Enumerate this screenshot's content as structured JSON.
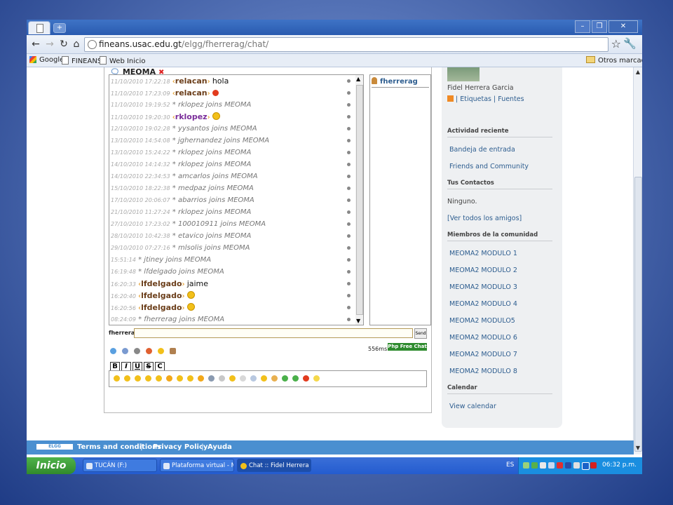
{
  "browser": {
    "url_host": "fineans.usac.edu.gt",
    "url_path": "/elgg/fherrerag/chat/",
    "bookmarks": [
      "Google",
      "FINEANS",
      "Web Inicio"
    ],
    "other_bookmarks": "Otros marcadores"
  },
  "chat": {
    "room_tab": "MEOMA",
    "messages": [
      {
        "ts": "11/10/2010 17:22:18",
        "nick": "relacan",
        "text": "hola",
        "kind": "msg"
      },
      {
        "ts": "11/10/2010 17:23:09",
        "nick": "relacan",
        "text": "",
        "kind": "alert"
      },
      {
        "ts": "11/10/2010 19:19:52",
        "text": "* rklopez joins MEOMA",
        "kind": "join"
      },
      {
        "ts": "11/10/2010 19:20:30",
        "nick": "rklopez",
        "text": "",
        "kind": "smile",
        "purple": true
      },
      {
        "ts": "12/10/2010 19:02:28",
        "text": "* yysantos joins MEOMA",
        "kind": "join"
      },
      {
        "ts": "13/10/2010 14:54:08",
        "text": "* jghernandez joins MEOMA",
        "kind": "join"
      },
      {
        "ts": "13/10/2010 15:24:22",
        "text": "* rklopez joins MEOMA",
        "kind": "join"
      },
      {
        "ts": "14/10/2010 14:14:32",
        "text": "* rklopez joins MEOMA",
        "kind": "join"
      },
      {
        "ts": "14/10/2010 22:34:53",
        "text": "* amcarlos joins MEOMA",
        "kind": "join"
      },
      {
        "ts": "15/10/2010 18:22:38",
        "text": "* medpaz joins MEOMA",
        "kind": "join"
      },
      {
        "ts": "17/10/2010 20:06:07",
        "text": "* abarrios joins MEOMA",
        "kind": "join"
      },
      {
        "ts": "21/10/2010 11:27:24",
        "text": "* rklopez joins MEOMA",
        "kind": "join"
      },
      {
        "ts": "27/10/2010 17:23:02",
        "text": "* 100010911 joins MEOMA",
        "kind": "join"
      },
      {
        "ts": "28/10/2010 10:42:38",
        "text": "* etavico joins MEOMA",
        "kind": "join"
      },
      {
        "ts": "29/10/2010 07:27:16",
        "text": "* mlsolis joins MEOMA",
        "kind": "join"
      },
      {
        "ts": "15:51:14",
        "text": "* jtiney joins MEOMA",
        "kind": "join"
      },
      {
        "ts": "16:19:48",
        "text": "* lfdelgado joins MEOMA",
        "kind": "join"
      },
      {
        "ts": "16:20:33",
        "nick": "lfdelgado",
        "text": "jaime",
        "kind": "msg"
      },
      {
        "ts": "16:20:40",
        "nick": "lfdelgado",
        "text": "",
        "kind": "smile"
      },
      {
        "ts": "16:20:56",
        "nick": "lfdelgado",
        "text": "",
        "kind": "smile"
      },
      {
        "ts": "08:24:09",
        "text": "* fherrerag joins MEOMA",
        "kind": "join"
      }
    ],
    "users": [
      "fherrerag"
    ],
    "current_user": "fherrerag",
    "send_label": "Send",
    "ping": "556ms",
    "badge": "Php Free Chat",
    "format_buttons": [
      "B",
      "I",
      "U",
      "S",
      "C"
    ]
  },
  "sidebar": {
    "owner_name": "Fidel Herrera Garcia",
    "owner_links": "| Etiquetas | Fuentes",
    "sections": [
      {
        "title": "Actividad reciente",
        "items": [
          "Bandeja de entrada",
          "Friends and Community"
        ]
      },
      {
        "title": "Tus Contactos",
        "items": []
      },
      {
        "title": "Miembros de la comunidad",
        "items": [
          "MEOMA2 MODULO 1",
          "MEOMA2 MODULO 2",
          "MEOMA2 MODULO 3",
          "MEOMA2 MODULO 4",
          "MEOMA2 MODULO5",
          "MEOMA2 MODULO 6",
          "MEOMA2 MODULO 7",
          "MEOMA2 MODULO 8"
        ]
      },
      {
        "title": "Calendar",
        "items": [
          "View calendar"
        ]
      }
    ],
    "contacts_none": "Ninguno.",
    "contacts_all": "[Ver todos los amigos]"
  },
  "footer": {
    "elgg_badge": "ELGG POWERED",
    "links": [
      "Terms and conditions",
      "Privacy Policy",
      "Ayuda"
    ]
  },
  "taskbar": {
    "start": "Inicio",
    "tasks": [
      "TUCÁN (F:)",
      "Plataforma virtual - M...",
      "Chat :: Fidel Herrera ..."
    ],
    "lang": "ES",
    "clock": "06:32 p.m."
  }
}
